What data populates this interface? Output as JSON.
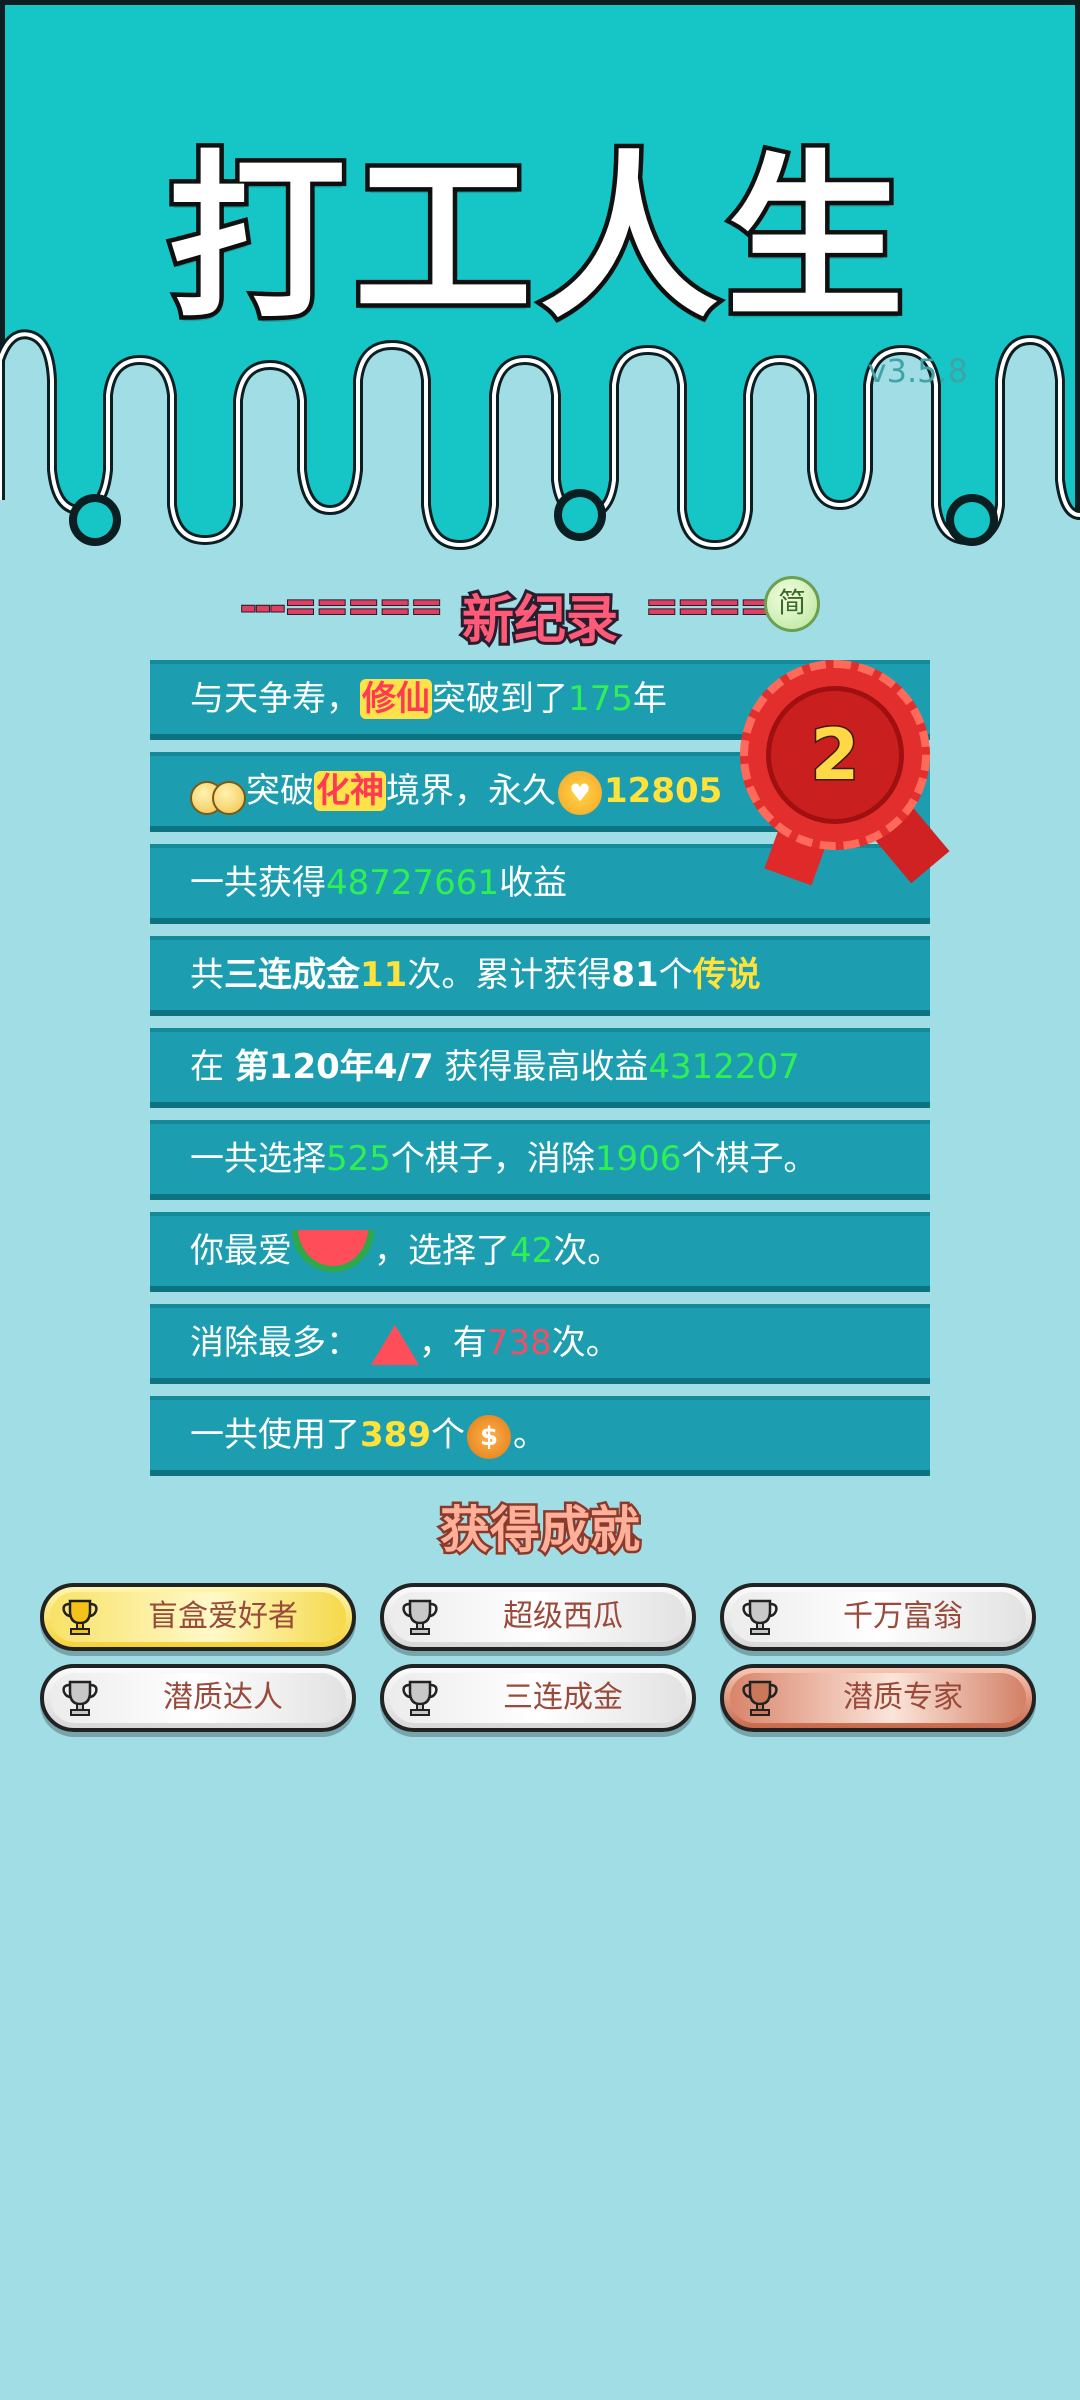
{
  "app_title": "打工人生",
  "version": "v3.5.8",
  "banner": {
    "text": "新纪录",
    "dashes_left": "---=====",
    "dashes_right": "=====-",
    "simplified_button": "简"
  },
  "rank_badge": "2",
  "records": [
    {
      "parts": [
        "与天争寿，",
        "修仙",
        "突破到了",
        "175",
        "年"
      ]
    },
    {
      "parts": [
        "突破",
        "化神",
        "境界，永久",
        "12805"
      ]
    },
    {
      "parts": [
        "一共获得",
        "48727661",
        "收益"
      ]
    },
    {
      "parts": [
        "共",
        "三连成金",
        "11",
        "次。累计获得",
        "81",
        "个",
        "传说"
      ]
    },
    {
      "parts": [
        "在 ",
        "第120年4/7",
        " 获得最高收益",
        "4312207"
      ]
    },
    {
      "parts": [
        "一共选择",
        "525",
        "个棋子，消除",
        "1906",
        "个棋子。"
      ]
    },
    {
      "parts": [
        "你最爱",
        "，选择了",
        "42",
        "次。"
      ]
    },
    {
      "parts": [
        "消除最多：",
        "，有",
        "738",
        "次。"
      ]
    },
    {
      "parts": [
        "一共使用了",
        "389",
        "个",
        "。"
      ]
    }
  ],
  "icons": {
    "heart_coin": "heart-coin-icon",
    "dollar_coin": "dollar-coin-icon",
    "coin_symbol": "$"
  },
  "achievements_title": "获得成就",
  "achievements": [
    {
      "label": "盲盒爱好者",
      "tier": "gold"
    },
    {
      "label": "超级西瓜",
      "tier": "silver"
    },
    {
      "label": "千万富翁",
      "tier": "silver"
    },
    {
      "label": "潜质达人",
      "tier": "silver"
    },
    {
      "label": "三连成金",
      "tier": "silver"
    },
    {
      "label": "潜质专家",
      "tier": "bronze"
    }
  ],
  "colors": {
    "background": "#a0dde5",
    "header": "#16c6c6",
    "row": "#1c9eb0",
    "highlight_green": "#2ef054",
    "highlight_yellow": "#ffe23a",
    "highlight_red": "#ef5066"
  }
}
